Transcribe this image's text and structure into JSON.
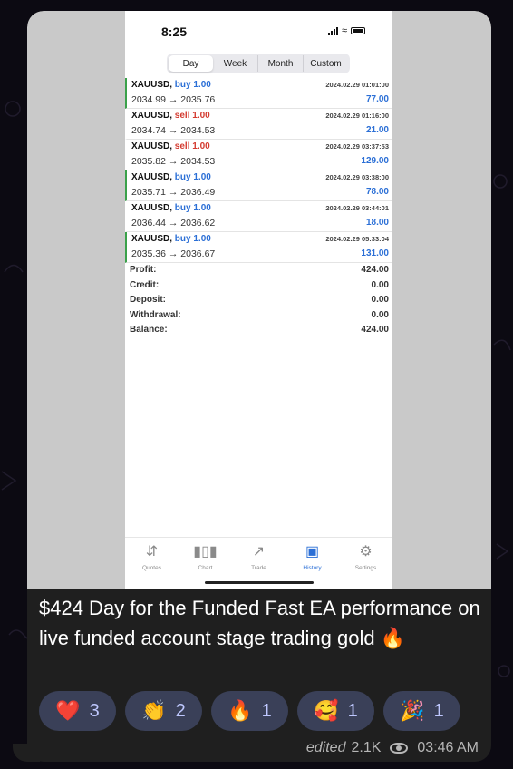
{
  "phone": {
    "time": "8:25",
    "segments": [
      "Day",
      "Week",
      "Month",
      "Custom"
    ],
    "active_segment": "Day",
    "deals": [
      {
        "symbol": "XAUUSD,",
        "side": "buy",
        "size": "1.00",
        "prices": "2034.99 → 2035.76",
        "datetime": "2024.02.29 01:01:00",
        "profit": "77.00"
      },
      {
        "symbol": "XAUUSD,",
        "side": "sell",
        "size": "1.00",
        "prices": "2034.74 → 2034.53",
        "datetime": "2024.02.29 01:16:00",
        "profit": "21.00"
      },
      {
        "symbol": "XAUUSD,",
        "side": "sell",
        "size": "1.00",
        "prices": "2035.82 → 2034.53",
        "datetime": "2024.02.29 03:37:53",
        "profit": "129.00"
      },
      {
        "symbol": "XAUUSD,",
        "side": "buy",
        "size": "1.00",
        "prices": "2035.71 → 2036.49",
        "datetime": "2024.02.29 03:38:00",
        "profit": "78.00"
      },
      {
        "symbol": "XAUUSD,",
        "side": "buy",
        "size": "1.00",
        "prices": "2036.44 → 2036.62",
        "datetime": "2024.02.29 03:44:01",
        "profit": "18.00"
      },
      {
        "symbol": "XAUUSD,",
        "side": "buy",
        "size": "1.00",
        "prices": "2035.36 → 2036.67",
        "datetime": "2024.02.29 05:33:04",
        "profit": "131.00"
      }
    ],
    "summary": [
      {
        "label": "Profit:",
        "value": "424.00"
      },
      {
        "label": "Credit:",
        "value": "0.00"
      },
      {
        "label": "Deposit:",
        "value": "0.00"
      },
      {
        "label": "Withdrawal:",
        "value": "0.00"
      },
      {
        "label": "Balance:",
        "value": "424.00"
      }
    ],
    "tabs": [
      {
        "label": "Quotes",
        "icon": "quotes-icon"
      },
      {
        "label": "Chart",
        "icon": "chart-icon"
      },
      {
        "label": "Trade",
        "icon": "trade-icon"
      },
      {
        "label": "History",
        "icon": "history-icon"
      },
      {
        "label": "Settings",
        "icon": "settings-icon"
      }
    ],
    "active_tab": "History"
  },
  "message": {
    "caption": "$424 Day for the Funded Fast EA performance on live funded account stage trading gold 🔥",
    "reactions": [
      {
        "emoji": "❤️",
        "count": "3"
      },
      {
        "emoji": "👏",
        "count": "2"
      },
      {
        "emoji": "🔥",
        "count": "1"
      },
      {
        "emoji": "🥰",
        "count": "1"
      },
      {
        "emoji": "🎉",
        "count": "1"
      }
    ],
    "edited_label": "edited",
    "views": "2.1K",
    "time": "03:46 AM"
  },
  "colors": {
    "buy": "#2b6fd6",
    "sell": "#d43a2f",
    "reaction_bg": "#3a4058",
    "bubble_bg": "#1f1f1f"
  }
}
